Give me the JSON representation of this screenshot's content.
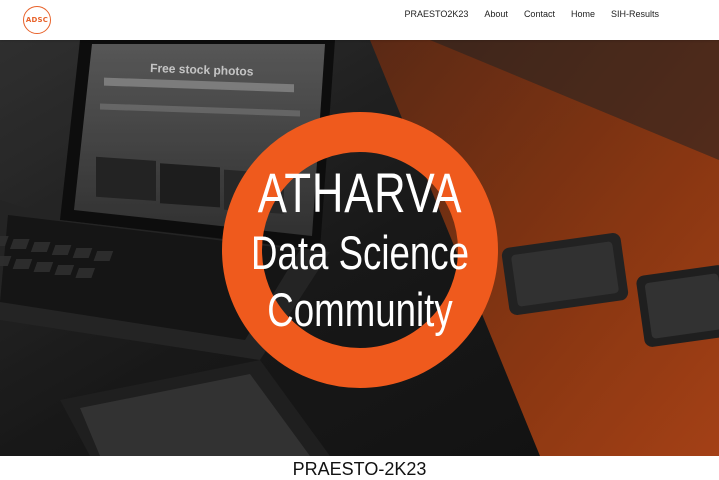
{
  "navbar": {
    "logo_text": "ADSC",
    "links": [
      "PRAESTO2K23",
      "About",
      "Contact",
      "Home",
      "SIH-Results"
    ]
  },
  "hero": {
    "line1": "ATHARVA",
    "line2": "Data Science",
    "line3": "Community",
    "screen_heading": "Free stock photos",
    "accent_color": "#ef5a1d"
  },
  "section": {
    "title": "PRAESTO-2K23"
  }
}
